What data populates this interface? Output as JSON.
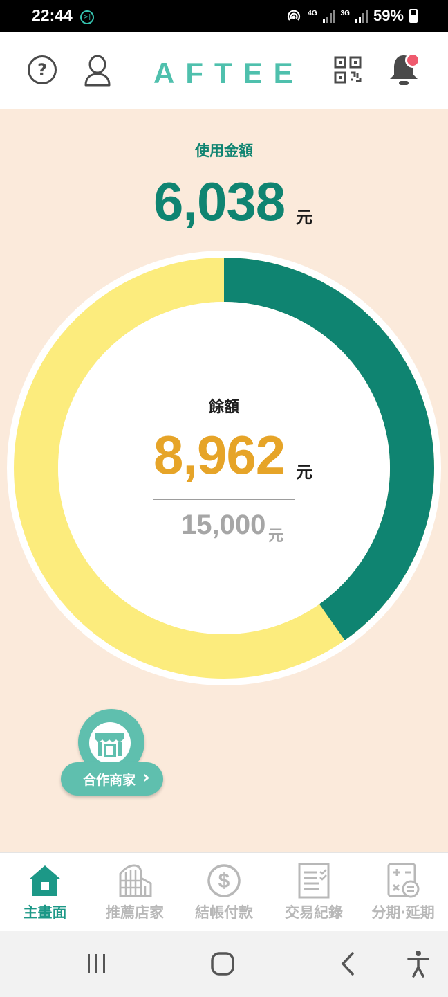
{
  "status_bar": {
    "time": "22:44",
    "notification_icon": ">|",
    "network_1": "4G",
    "network_2": "3G",
    "battery": "59%"
  },
  "header": {
    "brand": "AFTEE",
    "help_icon": "?"
  },
  "usage": {
    "used_label": "使用金額",
    "used_amount": "6,038",
    "unit": "元",
    "balance_label": "餘額",
    "balance_amount": "8,962",
    "limit_amount": "15,000",
    "used_fraction": 0.4025,
    "colors": {
      "used": "#0f8471",
      "remaining": "#fcec7d",
      "balance_text": "#e6a428"
    }
  },
  "partner": {
    "label": "合作商家",
    "chevron": "›"
  },
  "tabs": [
    {
      "label": "主畫面",
      "icon": "home-icon",
      "active": true
    },
    {
      "label": "推薦店家",
      "icon": "building-icon",
      "active": false
    },
    {
      "label": "結帳付款",
      "icon": "dollar-coin-icon",
      "active": false
    },
    {
      "label": "交易紀錄",
      "icon": "receipt-list-icon",
      "active": false
    },
    {
      "label": "分期‧延期",
      "icon": "calculator-icon",
      "active": false
    }
  ],
  "accent_color": "#1c9887"
}
